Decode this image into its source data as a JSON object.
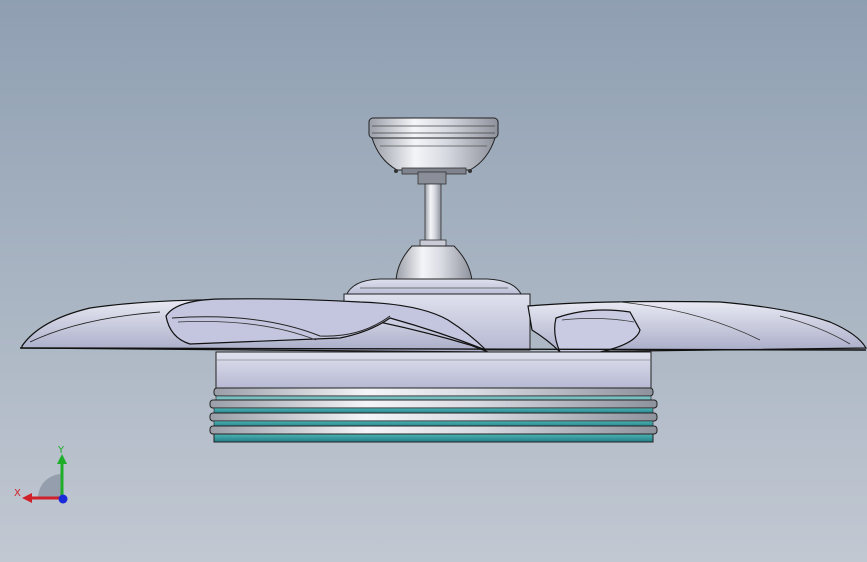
{
  "scene": {
    "background_top": "#8f9fb2",
    "background_bottom": "#c2c8d2",
    "model_body_color": "#c9cde6",
    "model_highlight_color": "#f2f3f7",
    "light_ring_color": "#2f9ba0",
    "edge_color": "#1a1a1a"
  },
  "triad": {
    "x_label": "X",
    "y_label": "Y",
    "x_color": "#d0202a",
    "y_color": "#1fae2a",
    "z_color": "#1a2ad8"
  }
}
